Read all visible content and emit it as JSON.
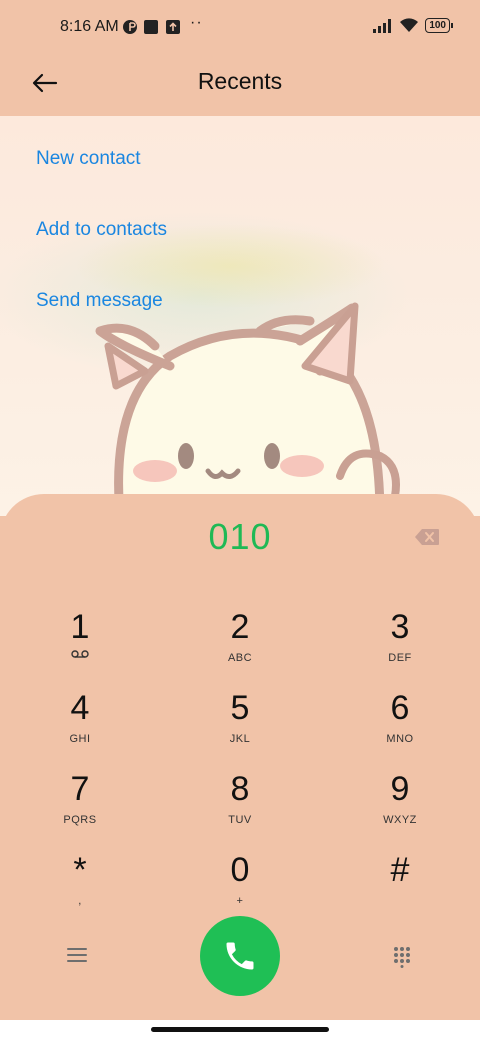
{
  "status_bar": {
    "time": "8:16 AM",
    "dots": "··",
    "battery": "100"
  },
  "header": {
    "title": "Recents",
    "back_icon": "arrow-left-icon"
  },
  "actions": [
    {
      "label": "New contact"
    },
    {
      "label": "Add to contacts"
    },
    {
      "label": "Send message"
    }
  ],
  "dialer": {
    "number": "010",
    "keys": [
      {
        "digit": "1",
        "letters": ""
      },
      {
        "digit": "2",
        "letters": "ABC"
      },
      {
        "digit": "3",
        "letters": "DEF"
      },
      {
        "digit": "4",
        "letters": "GHI"
      },
      {
        "digit": "5",
        "letters": "JKL"
      },
      {
        "digit": "6",
        "letters": "MNO"
      },
      {
        "digit": "7",
        "letters": "PQRS"
      },
      {
        "digit": "8",
        "letters": "TUV"
      },
      {
        "digit": "9",
        "letters": "WXYZ"
      },
      {
        "digit": "*",
        "letters": ","
      },
      {
        "digit": "0",
        "letters": "+"
      },
      {
        "digit": "#",
        "letters": ""
      }
    ]
  },
  "colors": {
    "panel": "#f1c3a8",
    "link": "#1a86e0",
    "number": "#1fb955",
    "call": "#1fbf55"
  }
}
